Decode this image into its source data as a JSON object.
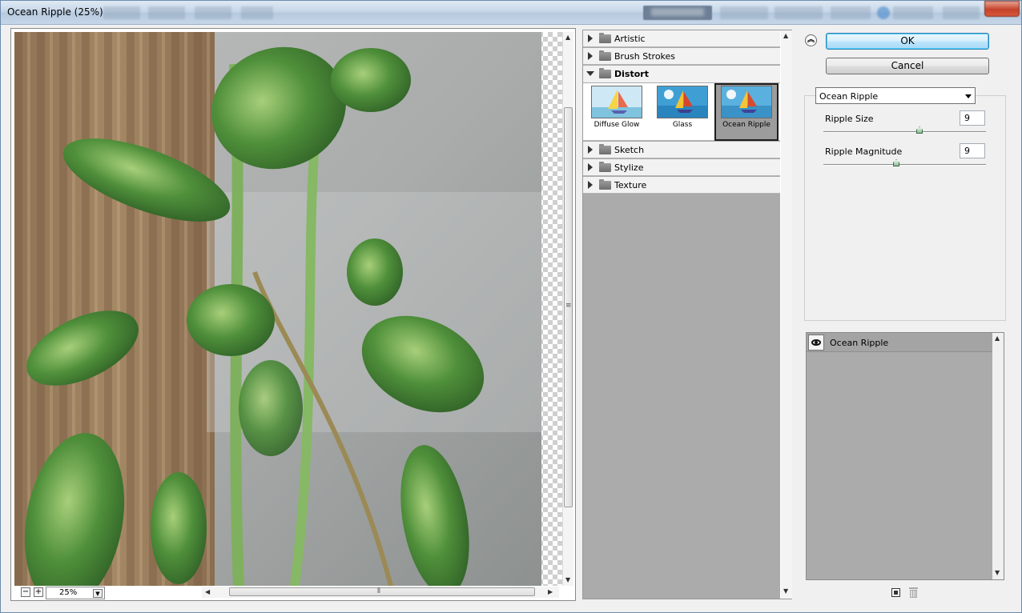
{
  "window": {
    "title": "Ocean Ripple (25%)"
  },
  "preview": {
    "zoom_value": "25%",
    "zoom_out_symbol": "−",
    "zoom_in_symbol": "+"
  },
  "gallery": {
    "categories_top": [
      {
        "label": "Artistic"
      },
      {
        "label": "Brush Strokes"
      },
      {
        "label": "Distort"
      }
    ],
    "distort_filters": [
      {
        "label": "Diffuse Glow"
      },
      {
        "label": "Glass"
      },
      {
        "label": "Ocean Ripple"
      }
    ],
    "categories_bottom": [
      {
        "label": "Sketch"
      },
      {
        "label": "Stylize"
      },
      {
        "label": "Texture"
      }
    ]
  },
  "actions": {
    "ok_label": "OK",
    "cancel_label": "Cancel"
  },
  "settings": {
    "selected_filter": "Ocean Ripple",
    "params": [
      {
        "label": "Ripple Size",
        "value": "9",
        "level": 0.6
      },
      {
        "label": "Ripple Magnitude",
        "value": "9",
        "level": 0.45
      }
    ]
  },
  "layers": {
    "items": [
      {
        "label": "Ocean Ripple"
      }
    ]
  },
  "icons": {
    "collapse": "double-chevron-up-icon",
    "visibility": "eye-icon",
    "new_layer": "new-effect-layer-icon",
    "delete_layer": "trash-icon"
  },
  "colors": {
    "ok_border": "#3c7fb1",
    "selected_thumb_bg": "#9c9c9c",
    "list_bg": "#ababab"
  }
}
